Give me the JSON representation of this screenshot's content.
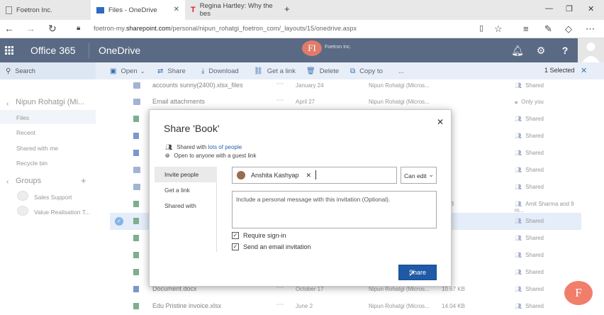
{
  "browser": {
    "tabs": [
      {
        "label": "Foetron Inc."
      },
      {
        "label": "Files - OneDrive"
      },
      {
        "label": "Regina Hartley: Why the bes"
      }
    ],
    "url_prefix": "foetron-my.",
    "url_domain": "sharepoint.com",
    "url_path": "/personal/nipun_rohatgi_foetron_com/_layouts/15/onedrive.aspx"
  },
  "suite": {
    "app_launcher": "Office 365",
    "app_name": "OneDrive",
    "logo_text": "FI",
    "org_name": "Foetron Inc."
  },
  "commands": {
    "search": "Search",
    "open": "Open",
    "share": "Share",
    "download": "Download",
    "get_link": "Get a link",
    "delete": "Delete",
    "copy_to": "Copy to",
    "more": "...",
    "selected": "1 Selected"
  },
  "leftnav": {
    "user": "Nipun Rohatgi (Mi...",
    "items": [
      "Files",
      "Recent",
      "Shared with me",
      "Recycle bin"
    ],
    "groups_header": "Groups",
    "groups": [
      "Sales Support",
      "Value Realisation T..."
    ]
  },
  "files": [
    {
      "name": "accounts sunny(2400).xlsx_files",
      "date": "January 24",
      "modifier": "Nipun Rohatgi (Micros...",
      "size": "",
      "sharing": "Shared"
    },
    {
      "name": "Email attachments",
      "date": "April 27",
      "modifier": "Nipun Rohatgi (Micros...",
      "size": "",
      "sharing": "Only you"
    },
    {
      "name": "",
      "date": "",
      "modifier": "",
      "size": "",
      "sharing": "Shared"
    },
    {
      "name": "",
      "date": "",
      "modifier": "",
      "size": "",
      "sharing": "Shared"
    },
    {
      "name": "",
      "date": "",
      "modifier": "",
      "size": "",
      "sharing": "Shared"
    },
    {
      "name": "",
      "date": "",
      "modifier": "",
      "size": "",
      "sharing": "Shared"
    },
    {
      "name": "",
      "date": "",
      "modifier": "",
      "size": "",
      "sharing": "Shared"
    },
    {
      "name": "",
      "date": "",
      "modifier": "",
      "size": "3 KB",
      "sharing": "Amit Sharma and 9 m..."
    },
    {
      "name": "",
      "date": "",
      "modifier": "",
      "size": "KB",
      "sharing": "Shared"
    },
    {
      "name": "",
      "date": "",
      "modifier": "",
      "size": "KB",
      "sharing": "Shared"
    },
    {
      "name": "",
      "date": "",
      "modifier": "",
      "size": "KB",
      "sharing": "Shared"
    },
    {
      "name": "",
      "date": "",
      "modifier": "",
      "size": "KB",
      "sharing": "Shared"
    },
    {
      "name": "Document.docx",
      "date": "October 17",
      "modifier": "Nipun Rohatgi (Micros...",
      "size": "10.67 KB",
      "sharing": "Shared"
    },
    {
      "name": "Edu Pristine invoice.xlsx",
      "date": "June 2",
      "modifier": "Nipun Rohatgi (Micros...",
      "size": "14.04 KB",
      "sharing": "Shared"
    }
  ],
  "dialog": {
    "title": "Share 'Book'",
    "shared_prefix": "Shared with ",
    "shared_link": "lots of people",
    "guest_line": "Open to anyone with a guest link",
    "tabs": [
      "Invite people",
      "Get a link",
      "Shared with"
    ],
    "invitee": "Anshita Kashyap",
    "permission": "Can edit",
    "message_placeholder": "Include a personal message with this invitation (Optional).",
    "require_signin": "Require sign-in",
    "send_email": "Send an email invitation",
    "share_button": "Share"
  },
  "fab_letter": "F",
  "colors": {
    "suite_bar": "#5a6a84",
    "accent": "#1e5aa8",
    "brand_logo": "#e07b6a"
  }
}
